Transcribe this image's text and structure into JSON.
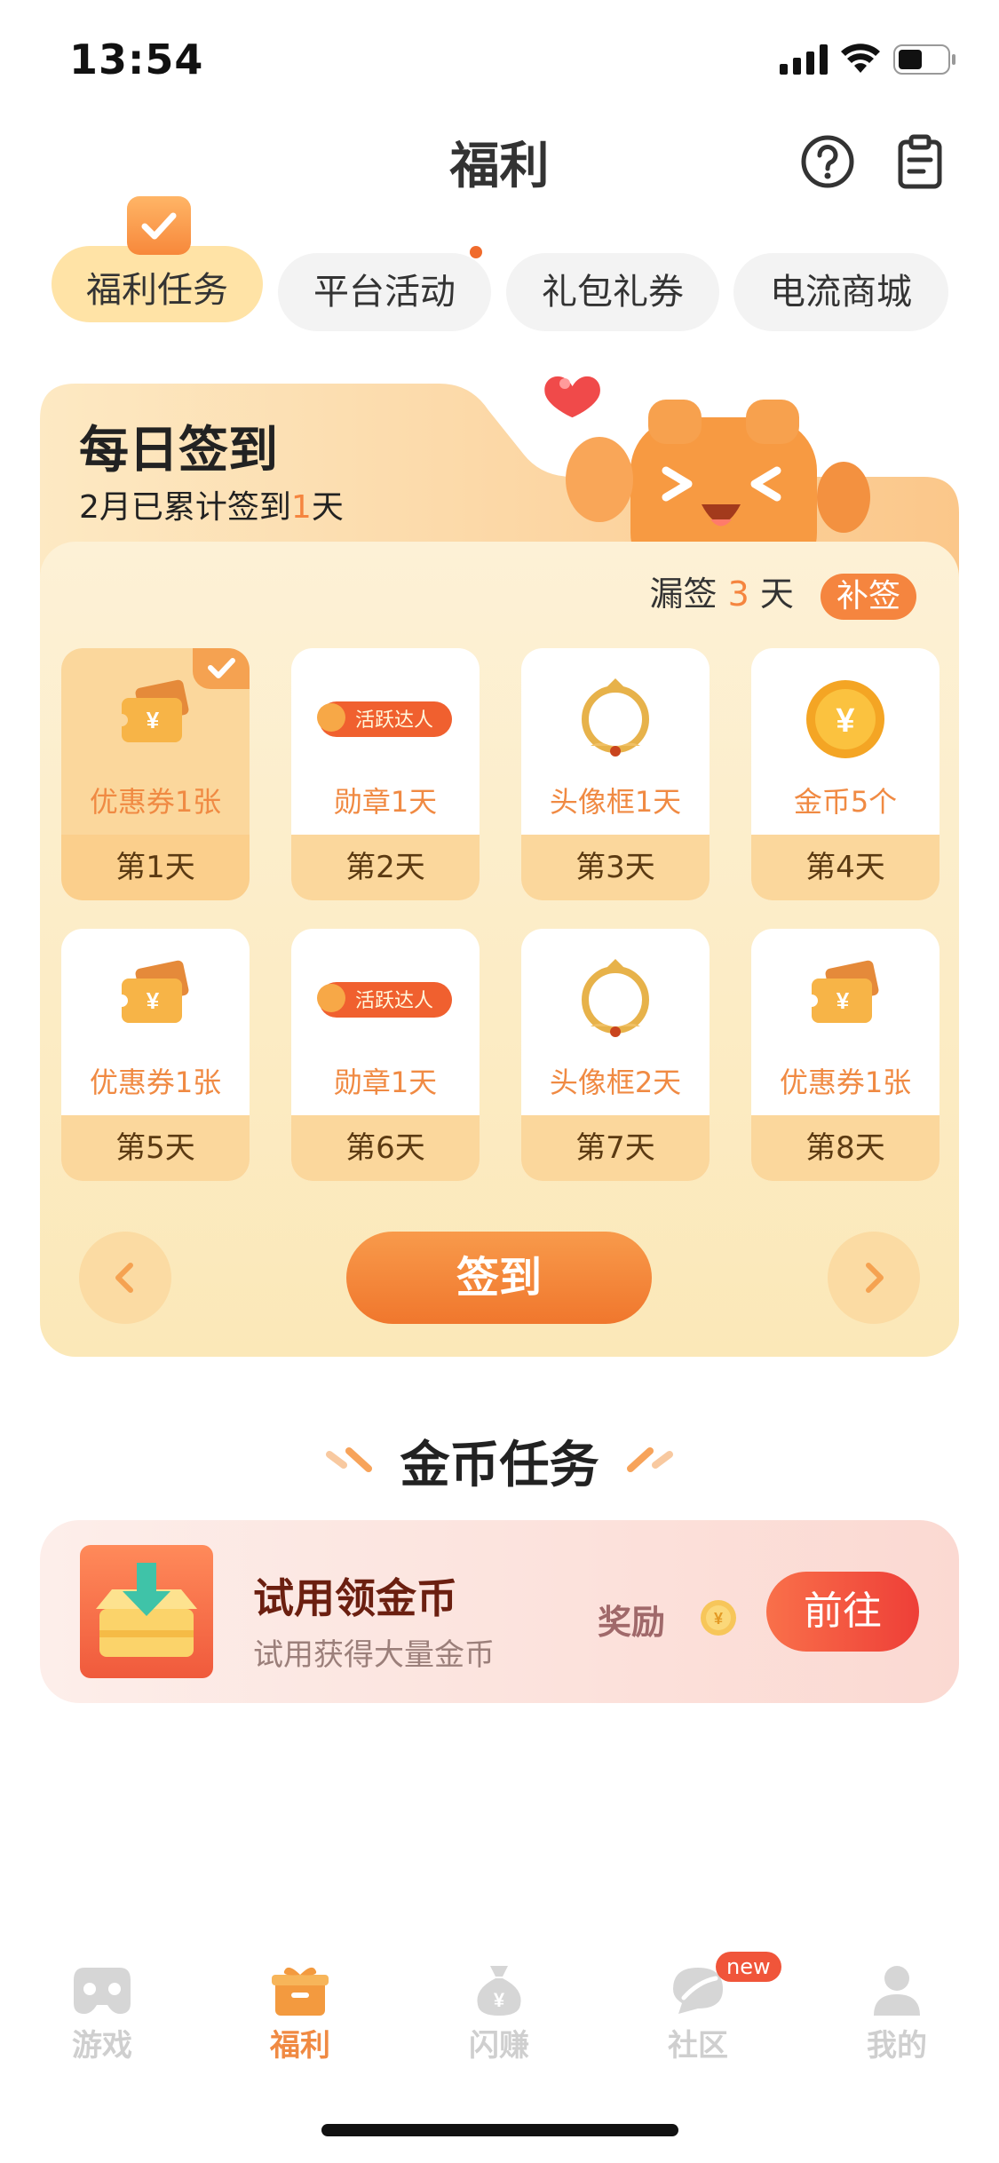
{
  "status_bar": {
    "time": "13:54"
  },
  "header": {
    "title": "福利",
    "help_icon": "help-circle-icon",
    "clipboard_icon": "clipboard-icon"
  },
  "tabs": [
    {
      "label": "福利任务",
      "active": true
    },
    {
      "label": "平台活动",
      "active": false,
      "dot": true
    },
    {
      "label": "礼包礼券",
      "active": false
    },
    {
      "label": "电流商城",
      "active": false
    }
  ],
  "signin": {
    "title": "每日签到",
    "sub_prefix": "2月已累计签到",
    "sub_count": "1",
    "sub_suffix": "天",
    "missed_prefix": "漏签",
    "missed_count": "3",
    "missed_suffix": "天",
    "makeup_label": "补签",
    "days": [
      {
        "reward": "优惠券1张",
        "day": "第1天",
        "type": "coupon",
        "done": true
      },
      {
        "reward": "勋章1天",
        "day": "第2天",
        "type": "badge",
        "badge_text": "活跃达人"
      },
      {
        "reward": "头像框1天",
        "day": "第3天",
        "type": "frame"
      },
      {
        "reward": "金币5个",
        "day": "第4天",
        "type": "coin"
      },
      {
        "reward": "优惠券1张",
        "day": "第5天",
        "type": "coupon"
      },
      {
        "reward": "勋章1天",
        "day": "第6天",
        "type": "badge",
        "badge_text": "活跃达人"
      },
      {
        "reward": "头像框2天",
        "day": "第7天",
        "type": "frame"
      },
      {
        "reward": "优惠券1张",
        "day": "第8天",
        "type": "coupon"
      }
    ],
    "sign_button": "签到",
    "prev_icon": "chevron-left-icon",
    "next_icon": "chevron-right-icon"
  },
  "coin_tasks": {
    "title": "金币任务",
    "task": {
      "name": "试用领金币",
      "desc": "试用获得大量金币",
      "reward_label": "奖励",
      "go_label": "前往"
    }
  },
  "bottom_nav": [
    {
      "label": "游戏",
      "icon": "gamepad-icon",
      "active": false
    },
    {
      "label": "福利",
      "icon": "gift-icon",
      "active": true
    },
    {
      "label": "闪赚",
      "icon": "money-bag-icon",
      "active": false
    },
    {
      "label": "社区",
      "icon": "community-icon",
      "active": false,
      "badge": "new"
    },
    {
      "label": "我的",
      "icon": "user-icon",
      "active": false
    }
  ],
  "colors": {
    "accent": "#f5853f",
    "tab_active_bg": "#ffe3a6",
    "go_button": "#ee3f38"
  }
}
